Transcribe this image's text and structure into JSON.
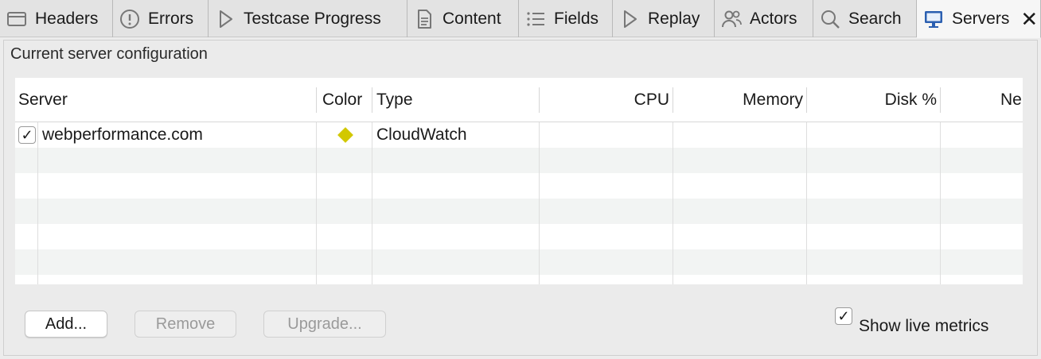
{
  "tabs": [
    {
      "label": "Headers",
      "icon": "headers-icon"
    },
    {
      "label": "Errors",
      "icon": "errors-icon"
    },
    {
      "label": "Testcase Progress",
      "icon": "play-icon"
    },
    {
      "label": "Content",
      "icon": "document-icon"
    },
    {
      "label": "Fields",
      "icon": "list-icon"
    },
    {
      "label": "Replay",
      "icon": "play-icon"
    },
    {
      "label": "Actors",
      "icon": "users-icon"
    },
    {
      "label": "Search",
      "icon": "search-icon"
    },
    {
      "label": "Servers",
      "icon": "monitor-icon",
      "active": true
    }
  ],
  "close_glyph": "✕",
  "panel": {
    "title": "Current server configuration"
  },
  "table": {
    "columns": [
      "Server",
      "Color",
      "Type",
      "CPU",
      "Memory",
      "Disk %",
      "Ne"
    ],
    "rows": [
      {
        "checked": true,
        "check_glyph": "✓",
        "server": "webperformance.com",
        "color": "#d2c800",
        "type": "CloudWatch",
        "cpu": "",
        "memory": "",
        "disk": ""
      }
    ]
  },
  "buttons": {
    "add": "Add...",
    "remove": "Remove",
    "upgrade": "Upgrade..."
  },
  "live_metrics": {
    "label": "Show live metrics",
    "checked": true,
    "check_glyph": "✓"
  }
}
